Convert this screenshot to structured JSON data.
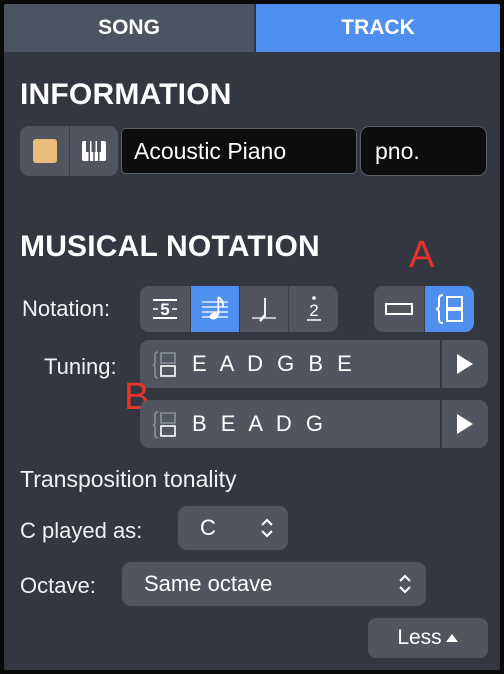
{
  "tabs": {
    "song": "SONG",
    "track": "TRACK"
  },
  "information": {
    "title": "INFORMATION",
    "instrument_name": "Acoustic Piano",
    "short_name": "pno.",
    "color": "#e8bd7b"
  },
  "notation_section": {
    "title": "MUSICAL NOTATION",
    "notation_label": "Notation:",
    "notation_modes": [
      "tablature-icon",
      "standard-notation-icon",
      "rhythm-slash-icon",
      "numbered-notation-icon"
    ],
    "active_mode_index": 1,
    "staff_options": [
      "single-staff-icon",
      "multi-staff-icon"
    ],
    "active_staff_index": 1,
    "tuning_label": "Tuning:",
    "tunings": [
      "E A D G B E",
      "B E A D G"
    ]
  },
  "annotations": {
    "a": "A",
    "b": "B"
  },
  "transposition": {
    "title": "Transposition tonality",
    "c_played_as_label": "C played as:",
    "c_played_as_value": "C",
    "octave_label": "Octave:",
    "octave_value": "Same octave"
  },
  "less_button": "Less",
  "colors": {
    "accent": "#4f8ff0",
    "panel": "#33373f",
    "control": "#50555f",
    "annotation": "#e8332a"
  }
}
